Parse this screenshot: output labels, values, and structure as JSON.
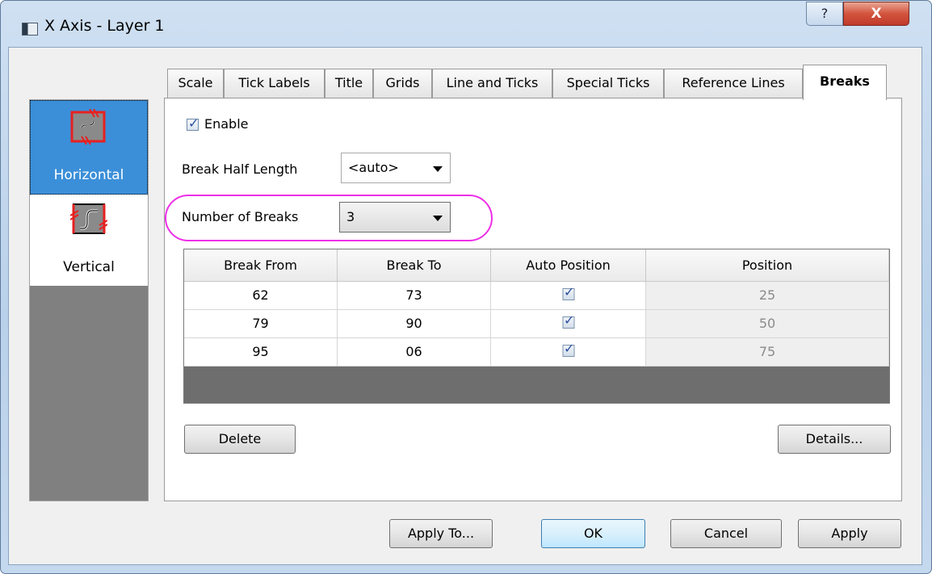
{
  "window": {
    "title": "X Axis - Layer 1",
    "help_label": "?",
    "close_label": "X"
  },
  "left_panel": {
    "items": [
      {
        "label": "Horizontal",
        "selected": true,
        "icon": "horizontal-break-icon"
      },
      {
        "label": "Vertical",
        "selected": false,
        "icon": "vertical-break-icon"
      }
    ]
  },
  "tabs": [
    {
      "label": "Scale"
    },
    {
      "label": "Tick Labels"
    },
    {
      "label": "Title"
    },
    {
      "label": "Grids"
    },
    {
      "label": "Line and Ticks"
    },
    {
      "label": "Special Ticks"
    },
    {
      "label": "Reference Lines"
    },
    {
      "label": "Breaks",
      "active": true
    }
  ],
  "breaks": {
    "enable_label": "Enable",
    "enable_checked": true,
    "half_length_label": "Break Half Length",
    "half_length_value": "<auto>",
    "num_breaks_label": "Number of Breaks",
    "num_breaks_value": "3",
    "table": {
      "headers": [
        "Break From",
        "Break To",
        "Auto Position",
        "Position"
      ],
      "rows": [
        {
          "from": "62",
          "to": "73",
          "auto": true,
          "position": "25"
        },
        {
          "from": "79",
          "to": "90",
          "auto": true,
          "position": "50"
        },
        {
          "from": "95",
          "to": "06",
          "auto": true,
          "position": "75"
        }
      ]
    },
    "delete_label": "Delete",
    "details_label": "Details..."
  },
  "footer": {
    "apply_to_label": "Apply To...",
    "ok_label": "OK",
    "cancel_label": "Cancel",
    "apply_label": "Apply"
  },
  "colors": {
    "selection": "#3b8fd8",
    "highlight_ring": "#ee2ee8",
    "close_button": "#c0392b"
  }
}
